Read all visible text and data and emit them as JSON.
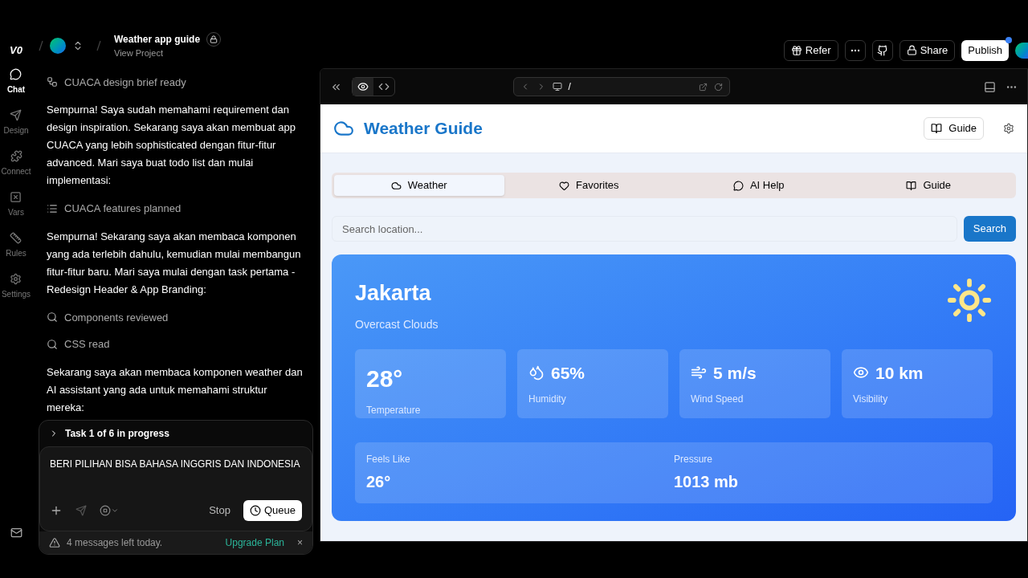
{
  "project": {
    "logo": "V0",
    "title": "Weather app guide",
    "subtitle": "View Project"
  },
  "rail": [
    {
      "label": "Chat",
      "selected": true
    },
    {
      "label": "Design",
      "selected": false
    },
    {
      "label": "Connect",
      "selected": false
    },
    {
      "label": "Vars",
      "selected": false
    },
    {
      "label": "Rules",
      "selected": false
    },
    {
      "label": "Settings",
      "selected": false
    }
  ],
  "chat": [
    {
      "kind": "step",
      "text": "CUACA design brief ready"
    },
    {
      "kind": "message",
      "text": "Sempurna! Saya sudah memahami requirement dan design inspiration. Sekarang saya akan membuat app CUACA yang lebih sophisticated dengan fitur-fitur advanced. Mari saya buat todo list dan mulai implementasi:"
    },
    {
      "kind": "step",
      "text": "CUACA features planned"
    },
    {
      "kind": "message",
      "text": "Sempurna! Sekarang saya akan membaca komponen yang ada terlebih dahulu, kemudian mulai membangun fitur-fitur baru. Mari saya mulai dengan task pertama - Redesign Header & App Branding:"
    },
    {
      "kind": "step",
      "text": "Components reviewed"
    },
    {
      "kind": "step",
      "text": "CSS read"
    },
    {
      "kind": "message",
      "text": "Sekarang saya akan membaca komponen weather dan AI assistant yang ada untuk memahami struktur mereka:"
    }
  ],
  "task": {
    "text": "Task 1 of 6 in progress",
    "expanded": false
  },
  "composer": {
    "value": "BERI PILIHAN BISA BAHASA INGGRIS DAN INDONESIA",
    "stop": "Stop",
    "queue": "Queue"
  },
  "notice": {
    "text": "4 messages left today.",
    "link": "Upgrade Plan",
    "close": "×"
  },
  "topbar": {
    "refer": "Refer",
    "share": "Share",
    "publish": "Publish",
    "publish_dot": true
  },
  "browser": {
    "path": "/"
  },
  "app": {
    "title": "Weather Guide",
    "guide_button": "Guide",
    "tabs": [
      {
        "label": "Weather",
        "selected": true
      },
      {
        "label": "Favorites",
        "selected": false
      },
      {
        "label": "AI Help",
        "selected": false
      },
      {
        "label": "Guide",
        "selected": false
      }
    ],
    "search": {
      "placeholder": "Search location...",
      "button": "Search"
    },
    "weather": {
      "city": "Jakarta",
      "condition": "Overcast Clouds",
      "stats": [
        {
          "value": "28°",
          "label": "Temperature"
        },
        {
          "value": "65%",
          "label": "Humidity"
        },
        {
          "value": "5 m/s",
          "label": "Wind Speed"
        },
        {
          "value": "10 km",
          "label": "Visibility"
        }
      ],
      "extra": [
        {
          "label": "Feels Like",
          "value": "26°"
        },
        {
          "label": "Pressure",
          "value": "1013 mb"
        }
      ]
    }
  }
}
